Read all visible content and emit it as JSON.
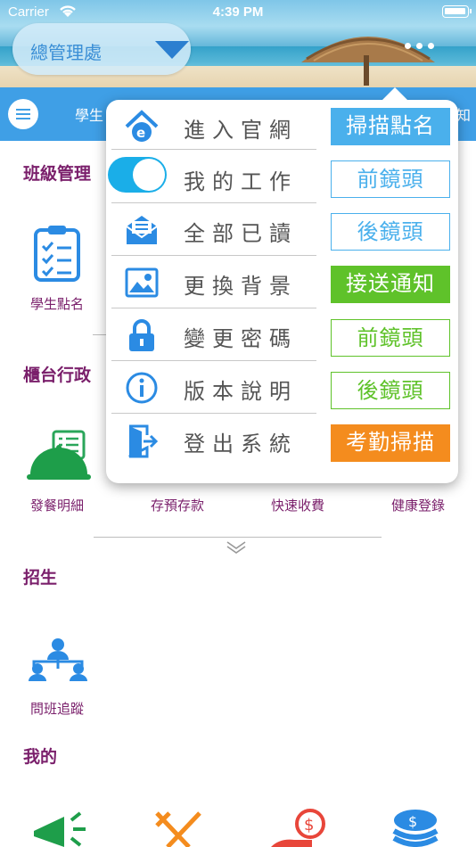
{
  "status": {
    "carrier": "Carrier",
    "time": "4:39 PM"
  },
  "header": {
    "department": "總管理處"
  },
  "navbar": {
    "tabs": [
      "學生",
      "知"
    ]
  },
  "sections": [
    {
      "title": "班級管理",
      "items": [
        "學生點名"
      ]
    },
    {
      "title": "櫃台行政",
      "items": [
        "發餐明細",
        "存預存款",
        "快速收費",
        "健康登錄"
      ]
    },
    {
      "title": "招生",
      "items": [
        "問班追蹤"
      ]
    },
    {
      "title": "我的",
      "items": []
    }
  ],
  "menu": {
    "items": [
      {
        "label": "進入官網",
        "icon": "ie-home-icon"
      },
      {
        "label": "我的工作",
        "icon": "toggle-switch"
      },
      {
        "label": "全部已讀",
        "icon": "mail-open-icon"
      },
      {
        "label": "更換背景",
        "icon": "image-icon"
      },
      {
        "label": "變更密碼",
        "icon": "lock-icon"
      },
      {
        "label": "版本說明",
        "icon": "info-icon"
      },
      {
        "label": "登出系統",
        "icon": "logout-door-icon"
      }
    ],
    "tags": [
      {
        "label": "掃描點名",
        "style": "fill-blue"
      },
      {
        "label": "前鏡頭",
        "style": "out-blue"
      },
      {
        "label": "後鏡頭",
        "style": "out-blue"
      },
      {
        "label": "接送通知",
        "style": "fill-green"
      },
      {
        "label": "前鏡頭",
        "style": "out-green"
      },
      {
        "label": "後鏡頭",
        "style": "out-green"
      },
      {
        "label": "考勤掃描",
        "style": "fill-orange"
      }
    ]
  },
  "colors": {
    "accent": "#3f9fe6",
    "section": "#7a1f6b",
    "green": "#5fc22a",
    "orange": "#f48c1e"
  }
}
